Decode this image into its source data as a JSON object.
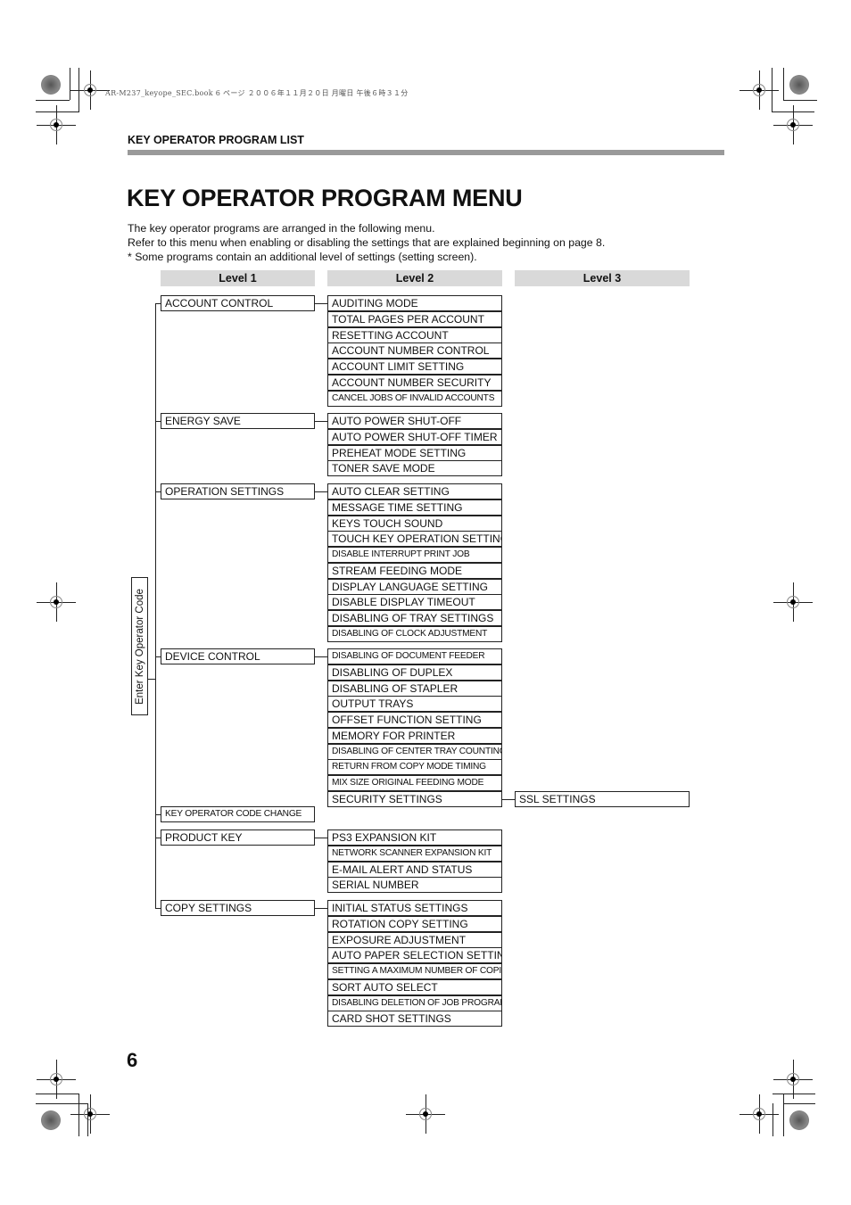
{
  "print_header": "AR-M237_keyope_SEC.book  6 ページ  ２００６年１１月２０日  月曜日  午後６時３１分",
  "section_label": "KEY OPERATOR PROGRAM LIST",
  "title": "KEY OPERATOR PROGRAM MENU",
  "intro": [
    "The key operator programs are arranged in the following menu.",
    "Refer to this menu when enabling or disabling the settings that are explained beginning on page 8.",
    "* Some programs contain an additional level of settings (setting screen)."
  ],
  "level_headers": [
    "Level 1",
    "Level 2",
    "Level 3"
  ],
  "entry_label": "Enter Key Operator Code",
  "menu": [
    {
      "label": "ACCOUNT CONTROL",
      "items": [
        {
          "label": "AUDITING MODE"
        },
        {
          "label": "TOTAL PAGES PER ACCOUNT"
        },
        {
          "label": "RESETTING ACCOUNT"
        },
        {
          "label": "ACCOUNT NUMBER CONTROL"
        },
        {
          "label": "ACCOUNT LIMIT SETTING"
        },
        {
          "label": "ACCOUNT NUMBER SECURITY"
        },
        {
          "label": "CANCEL JOBS OF INVALID ACCOUNTS",
          "small": true
        }
      ]
    },
    {
      "label": "ENERGY SAVE",
      "items": [
        {
          "label": "AUTO POWER SHUT-OFF"
        },
        {
          "label": "AUTO POWER SHUT-OFF TIMER"
        },
        {
          "label": "PREHEAT MODE SETTING"
        },
        {
          "label": "TONER SAVE MODE"
        }
      ]
    },
    {
      "label": "OPERATION SETTINGS",
      "items": [
        {
          "label": "AUTO CLEAR SETTING"
        },
        {
          "label": "MESSAGE TIME SETTING"
        },
        {
          "label": "KEYS TOUCH SOUND"
        },
        {
          "label": "TOUCH KEY OPERATION SETTING"
        },
        {
          "label": "DISABLE INTERRUPT PRINT JOB",
          "small": true
        },
        {
          "label": "STREAM FEEDING MODE"
        },
        {
          "label": "DISPLAY LANGUAGE SETTING"
        },
        {
          "label": "DISABLE DISPLAY TIMEOUT"
        },
        {
          "label": "DISABLING OF TRAY SETTINGS"
        },
        {
          "label": "DISABLING OF CLOCK ADJUSTMENT",
          "small": true
        }
      ]
    },
    {
      "label": "DEVICE CONTROL",
      "items": [
        {
          "label": "DISABLING OF DOCUMENT FEEDER",
          "small": true
        },
        {
          "label": "DISABLING OF DUPLEX"
        },
        {
          "label": "DISABLING OF STAPLER"
        },
        {
          "label": "OUTPUT TRAYS"
        },
        {
          "label": "OFFSET FUNCTION SETTING"
        },
        {
          "label": "MEMORY FOR PRINTER"
        },
        {
          "label": "DISABLING OF CENTER TRAY COUNTING",
          "small": true
        },
        {
          "label": "RETURN FROM COPY MODE TIMING",
          "small": true
        },
        {
          "label": "MIX SIZE ORIGINAL FEEDING MODE",
          "small": true
        },
        {
          "label": "SECURITY SETTINGS",
          "level3": "SSL SETTINGS"
        }
      ]
    },
    {
      "label": "KEY OPERATOR CODE CHANGE",
      "small": true,
      "items": []
    },
    {
      "label": "PRODUCT KEY",
      "items": [
        {
          "label": "PS3 EXPANSION KIT"
        },
        {
          "label": "NETWORK SCANNER EXPANSION KIT",
          "small": true
        },
        {
          "label": "E-MAIL ALERT AND STATUS"
        },
        {
          "label": "SERIAL NUMBER"
        }
      ]
    },
    {
      "label": "COPY SETTINGS",
      "items": [
        {
          "label": "INITIAL STATUS SETTINGS"
        },
        {
          "label": "ROTATION COPY SETTING"
        },
        {
          "label": "EXPOSURE ADJUSTMENT"
        },
        {
          "label": "AUTO PAPER SELECTION SETTING"
        },
        {
          "label": "SETTING A MAXIMUM NUMBER OF COPIES",
          "small": true
        },
        {
          "label": "SORT AUTO SELECT"
        },
        {
          "label": "DISABLING DELETION OF JOB PROGRAMS",
          "small": true
        },
        {
          "label": "CARD SHOT SETTINGS"
        }
      ]
    }
  ],
  "page_number": "6"
}
